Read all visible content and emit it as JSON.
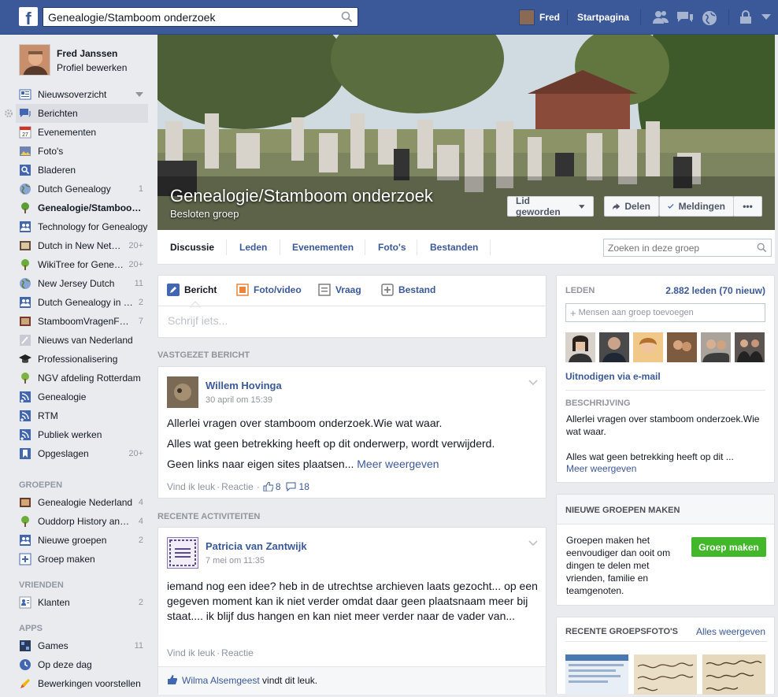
{
  "topbar": {
    "search_value": "Genealogie/Stamboom onderzoek",
    "user_name": "Fred",
    "home_label": "Startpagina"
  },
  "profile": {
    "name": "Fred Janssen",
    "edit_label": "Profiel bewerken"
  },
  "nav": {
    "favorites": [
      {
        "label": "Nieuwsoverzicht",
        "count": ""
      },
      {
        "label": "Berichten",
        "count": ""
      },
      {
        "label": "Evenementen",
        "count": ""
      },
      {
        "label": "Foto's",
        "count": ""
      },
      {
        "label": "Bladeren",
        "count": ""
      },
      {
        "label": "Dutch Genealogy",
        "count": "1"
      },
      {
        "label": "Genealogie/Stamboom onderzoek",
        "count": ""
      },
      {
        "label": "Technology for Genealogy",
        "count": ""
      },
      {
        "label": "Dutch in New Netherland",
        "count": "20+"
      },
      {
        "label": "WikiTree for Genealogy",
        "count": "20+"
      },
      {
        "label": "New Jersey Dutch",
        "count": "11"
      },
      {
        "label": "Dutch Genealogy in English",
        "count": "2"
      },
      {
        "label": "StamboomVragenForum",
        "count": "7"
      },
      {
        "label": "Nieuws van Nederland",
        "count": ""
      },
      {
        "label": "Professionalisering",
        "count": ""
      },
      {
        "label": "NGV afdeling Rotterdam",
        "count": ""
      },
      {
        "label": "Genealogie",
        "count": ""
      },
      {
        "label": "RTM",
        "count": ""
      },
      {
        "label": "Publiek werken",
        "count": ""
      },
      {
        "label": "Opgeslagen",
        "count": "20+"
      }
    ],
    "groups_title": "GROEPEN",
    "groups": [
      {
        "label": "Genealogie Nederland",
        "count": "4"
      },
      {
        "label": "Ouddorp History and more",
        "count": "4"
      },
      {
        "label": "Nieuwe groepen",
        "count": "2"
      },
      {
        "label": "Groep maken",
        "count": ""
      }
    ],
    "friends_title": "VRIENDEN",
    "friends": [
      {
        "label": "Klanten",
        "count": "2"
      }
    ],
    "apps_title": "APPS",
    "apps": [
      {
        "label": "Games",
        "count": "11"
      },
      {
        "label": "Op deze dag",
        "count": ""
      },
      {
        "label": "Bewerkingen voorstellen",
        "count": ""
      }
    ]
  },
  "group": {
    "title": "Genealogie/Stamboom onderzoek",
    "subtitle": "Besloten groep",
    "joined_label": "Lid geworden",
    "share_label": "Delen",
    "notifications_label": "Meldingen",
    "more_label": "•••",
    "tabs": [
      "Discussie",
      "Leden",
      "Evenementen",
      "Foto's",
      "Bestanden"
    ],
    "search_placeholder": "Zoeken in deze groep"
  },
  "composer": {
    "tabs": [
      "Bericht",
      "Foto/video",
      "Vraag",
      "Bestand"
    ],
    "placeholder": "Schrijf iets..."
  },
  "pinned": {
    "section_title": "VASTGEZET BERICHT",
    "author": "Willem Hovinga",
    "time": "30 april om 15:39",
    "lines": [
      "Allerlei vragen over stamboom onderzoek.Wie wat waar.",
      "Alles wat geen betrekking heeft op dit onderwerp, wordt verwijderd.",
      "Geen links naar eigen sites plaatsen..."
    ],
    "more_label": "Meer weergeven",
    "like_label": "Vind ik leuk",
    "comment_label": "Reactie",
    "likes": "8",
    "comments": "18"
  },
  "recent": {
    "section_title": "RECENTE ACTIVITEITEN",
    "author": "Patricia van Zantwijk",
    "time": "7 mei om 11:35",
    "text": "iemand nog een idee? heb in de utrechtse archieven laats gezocht... op een gegeven moment kan ik niet verder omdat daar geen plaatsnaam meer bij staat.... ik blijf dus hangen en kan niet meer verder naar de vader van...",
    "like_label": "Vind ik leuk",
    "comment_label": "Reactie",
    "liker": "Wilma Alsemgeest",
    "liked_suffix": "vindt dit leuk."
  },
  "members": {
    "title": "LEDEN",
    "count": "2.882 leden (70 nieuw)",
    "add_placeholder": "Mensen aan groep toevoegen",
    "invite_label": "Uitnodigen via e-mail",
    "desc_title": "BESCHRIJVING",
    "desc_text": "Allerlei vragen over stamboom onderzoek.Wie wat waar.",
    "desc_text2": "Alles wat geen betrekking heeft op dit ...",
    "more_label": "Meer weergeven"
  },
  "create_group": {
    "title": "NIEUWE GROEPEN MAKEN",
    "text": "Groepen maken het eenvoudiger dan ooit om dingen te delen met vrienden, familie en teamgenoten.",
    "button": "Groep maken"
  },
  "photos": {
    "title": "RECENTE GROEPSFOTO'S",
    "see_all": "Alles weergeven"
  },
  "colors": {
    "brand": "#3b5998",
    "link": "#3b5998",
    "green": "#42b72a"
  }
}
